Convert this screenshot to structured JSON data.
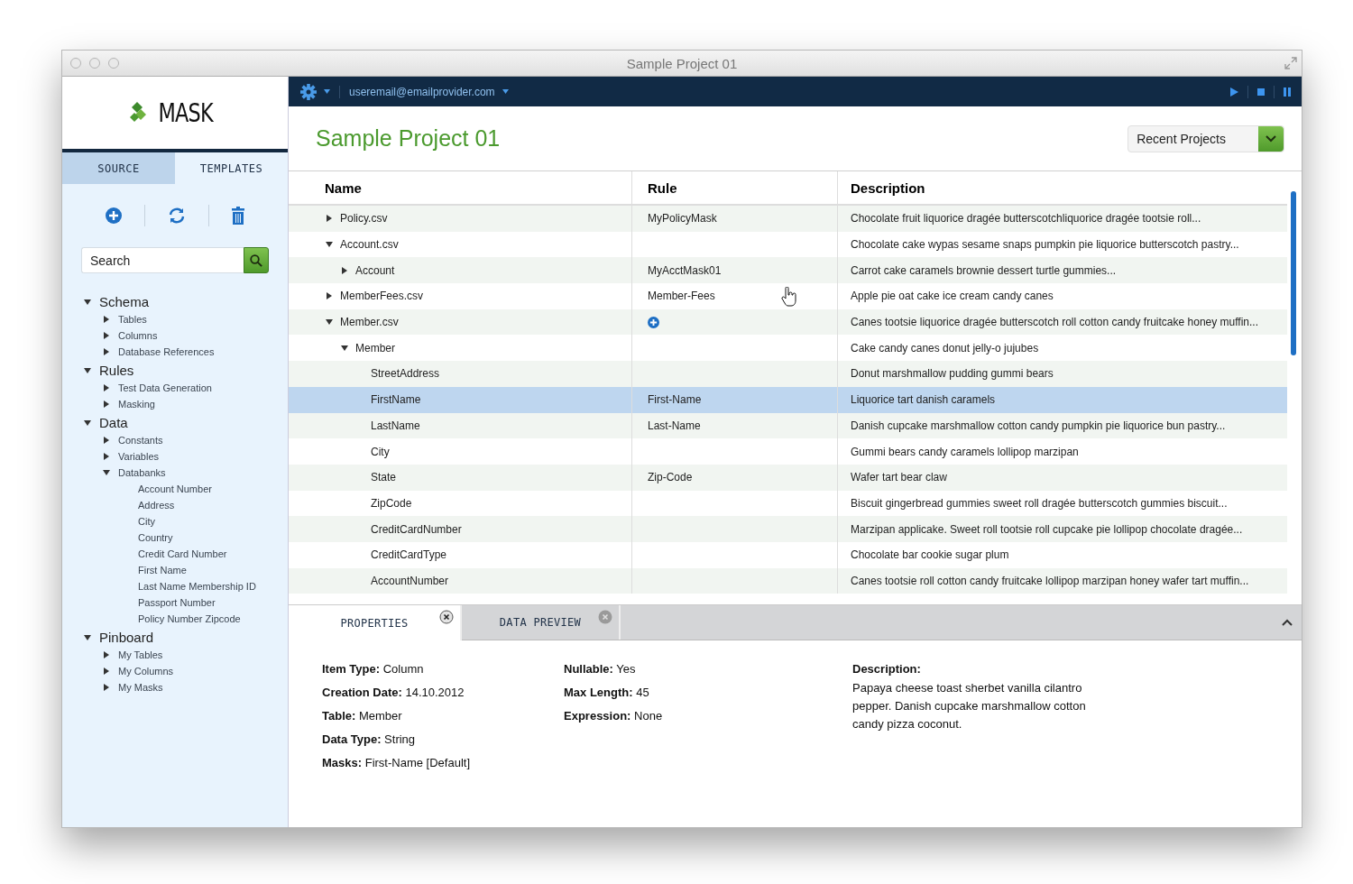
{
  "window": {
    "title": "Sample Project 01"
  },
  "logo": {
    "text": "MASK"
  },
  "sidebar": {
    "tabs": [
      {
        "label": "SOURCE",
        "selected": true
      },
      {
        "label": "TEMPLATES",
        "selected": false
      }
    ],
    "search": {
      "placeholder": "Search"
    },
    "tree": [
      {
        "label": "Schema",
        "expanded": true,
        "children": [
          {
            "label": "Tables",
            "expanded": false
          },
          {
            "label": "Columns",
            "expanded": false
          },
          {
            "label": "Database References",
            "expanded": false
          }
        ]
      },
      {
        "label": "Rules",
        "expanded": true,
        "children": [
          {
            "label": "Test Data Generation",
            "expanded": false
          },
          {
            "label": "Masking",
            "expanded": false
          }
        ]
      },
      {
        "label": "Data",
        "expanded": true,
        "children": [
          {
            "label": "Constants",
            "expanded": false
          },
          {
            "label": "Variables",
            "expanded": false
          },
          {
            "label": "Databanks",
            "expanded": true,
            "children": [
              {
                "label": "Account Number"
              },
              {
                "label": "Address"
              },
              {
                "label": "City"
              },
              {
                "label": "Country"
              },
              {
                "label": "Credit Card Number"
              },
              {
                "label": "First Name"
              },
              {
                "label": "Last Name Membership ID"
              },
              {
                "label": "Passport Number"
              },
              {
                "label": "Policy Number Zipcode"
              }
            ]
          }
        ]
      },
      {
        "label": "Pinboard",
        "expanded": true,
        "children": [
          {
            "label": "My Tables",
            "expanded": false
          },
          {
            "label": "My Columns",
            "expanded": false
          },
          {
            "label": "My Masks",
            "expanded": false
          }
        ]
      }
    ]
  },
  "topbar": {
    "user": "useremail@emailprovider.com"
  },
  "header": {
    "title": "Sample Project 01",
    "dropdown": "Recent Projects"
  },
  "table": {
    "columns": [
      "Name",
      "Rule",
      "Description"
    ],
    "rows": [
      {
        "kind": "group",
        "expanded": false,
        "selected": false,
        "name": "Policy.csv",
        "rule": "MyPolicyMask",
        "description": "Chocolate fruit liquorice dragée butterscotchliquorice dragée tootsie roll..."
      },
      {
        "kind": "group",
        "expanded": true,
        "selected": false,
        "name": "Account.csv",
        "description": "Chocolate cake wypas sesame snaps pumpkin pie liquorice butterscotch pastry...",
        "children": [
          {
            "kind": "group",
            "expanded": false,
            "selected": false,
            "name": "Account",
            "rule": "MyAcctMask01",
            "description": "Carrot cake caramels brownie dessert turtle gummies..."
          }
        ]
      },
      {
        "kind": "group",
        "expanded": false,
        "selected": false,
        "name": "MemberFees.csv",
        "rule": "Member-Fees",
        "description": "Apple pie oat cake ice cream candy canes"
      },
      {
        "kind": "group",
        "expanded": true,
        "selected": false,
        "name": "Member.csv",
        "add_rule_button": true,
        "description": "Canes tootsie liquorice dragée butterscotch roll cotton candy fruitcake honey muffin...",
        "children": [
          {
            "kind": "group",
            "expanded": true,
            "selected": false,
            "name": "Member",
            "description": "Cake candy canes donut jelly-o jujubes",
            "children": [
              {
                "kind": "leaf",
                "selected": false,
                "name": "StreetAddress",
                "description": "Donut marshmallow pudding gummi bears"
              },
              {
                "kind": "leaf",
                "selected": true,
                "name": "FirstName",
                "rule": "First-Name",
                "description": "Liquorice tart danish caramels"
              },
              {
                "kind": "leaf",
                "selected": false,
                "name": "LastName",
                "rule": "Last-Name",
                "description": "Danish cupcake marshmallow cotton candy pumpkin pie liquorice bun pastry..."
              },
              {
                "kind": "leaf",
                "selected": false,
                "name": "City",
                "description": "Gummi bears candy caramels lollipop marzipan"
              },
              {
                "kind": "leaf",
                "selected": false,
                "name": "State",
                "rule": "Zip-Code",
                "description": "Wafer tart bear claw"
              },
              {
                "kind": "leaf",
                "selected": false,
                "name": "ZipCode",
                "description": "Biscuit gingerbread gummies sweet roll dragée butterscotch gummies biscuit..."
              },
              {
                "kind": "leaf",
                "selected": false,
                "name": "CreditCardNumber",
                "description": "Marzipan applicake. Sweet roll tootsie roll cupcake pie lollipop chocolate dragée..."
              },
              {
                "kind": "leaf",
                "selected": false,
                "name": "CreditCardType",
                "description": "Chocolate bar cookie sugar plum"
              },
              {
                "kind": "leaf",
                "selected": false,
                "name": "AccountNumber",
                "description": "Canes tootsie roll cotton candy fruitcake lollipop marzipan honey wafer tart muffin..."
              }
            ]
          }
        ]
      }
    ]
  },
  "panel": {
    "tabs": [
      {
        "label": "PROPERTIES",
        "selected": true
      },
      {
        "label": "DATA PREVIEW",
        "selected": false
      }
    ],
    "properties": [
      [
        {
          "label": "Item Type:",
          "value": "Column"
        },
        {
          "label": "Creation Date:",
          "value": "14.10.2012"
        },
        {
          "label": "Table:",
          "value": "Member"
        },
        {
          "label": "Data Type:",
          "value": "String"
        },
        {
          "label": "Masks:",
          "value": "First-Name [Default]"
        }
      ],
      [
        {
          "label": "Nullable:",
          "value": "Yes"
        },
        {
          "label": "Max Length:",
          "value": "45"
        },
        {
          "label": "Expression:",
          "value": "None"
        }
      ]
    ],
    "description": {
      "label": "Description:",
      "text": "Papaya cheese toast sherbet vanilla cilantro pepper. Danish cupcake marshmallow cotton candy pizza coconut."
    }
  }
}
